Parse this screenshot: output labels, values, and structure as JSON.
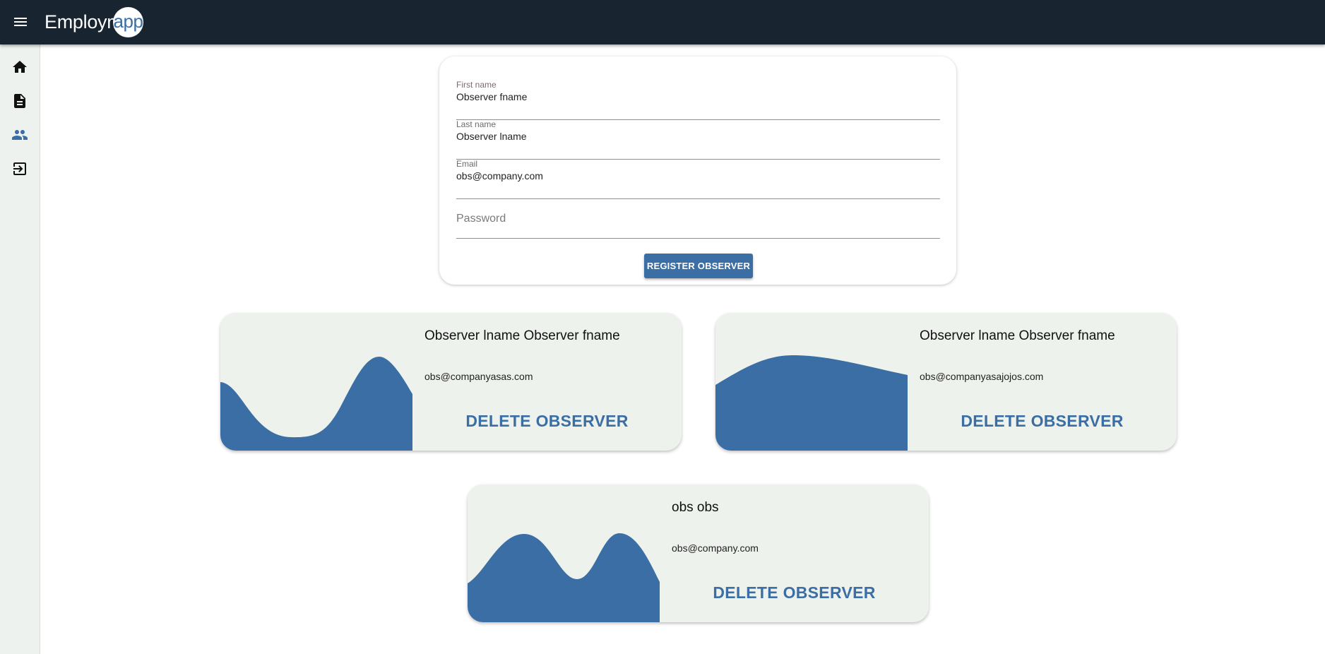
{
  "app": {
    "logo_main": "Employm",
    "logo_accent": "app"
  },
  "sidebar": {
    "items": [
      {
        "name": "home",
        "icon": "home-icon"
      },
      {
        "name": "document",
        "icon": "document-icon"
      },
      {
        "name": "people",
        "icon": "people-icon",
        "active": true
      },
      {
        "name": "logout",
        "icon": "exit-icon"
      }
    ]
  },
  "form": {
    "first_name": {
      "label": "First name",
      "value": "Observer fname"
    },
    "last_name": {
      "label": "Last name",
      "value": "Observer lname"
    },
    "email": {
      "label": "Email",
      "value": "obs@company.com"
    },
    "password": {
      "placeholder": "Password"
    },
    "submit_label": "REGISTER OBSERVER"
  },
  "observers": [
    {
      "name": "Observer lname Observer fname",
      "email": "obs@companyasas.com",
      "delete_label": "DELETE OBSERVER"
    },
    {
      "name": "Observer lname Observer fname",
      "email": "obs@companyasajojos.com",
      "delete_label": "DELETE OBSERVER"
    },
    {
      "name": "obs obs",
      "email": "obs@company.com",
      "delete_label": "DELETE OBSERVER"
    }
  ],
  "colors": {
    "topbar": "#182530",
    "accent": "#3a6ea5",
    "sidebar_bg": "#eef2ee",
    "card_bg": "#eef2ed"
  }
}
